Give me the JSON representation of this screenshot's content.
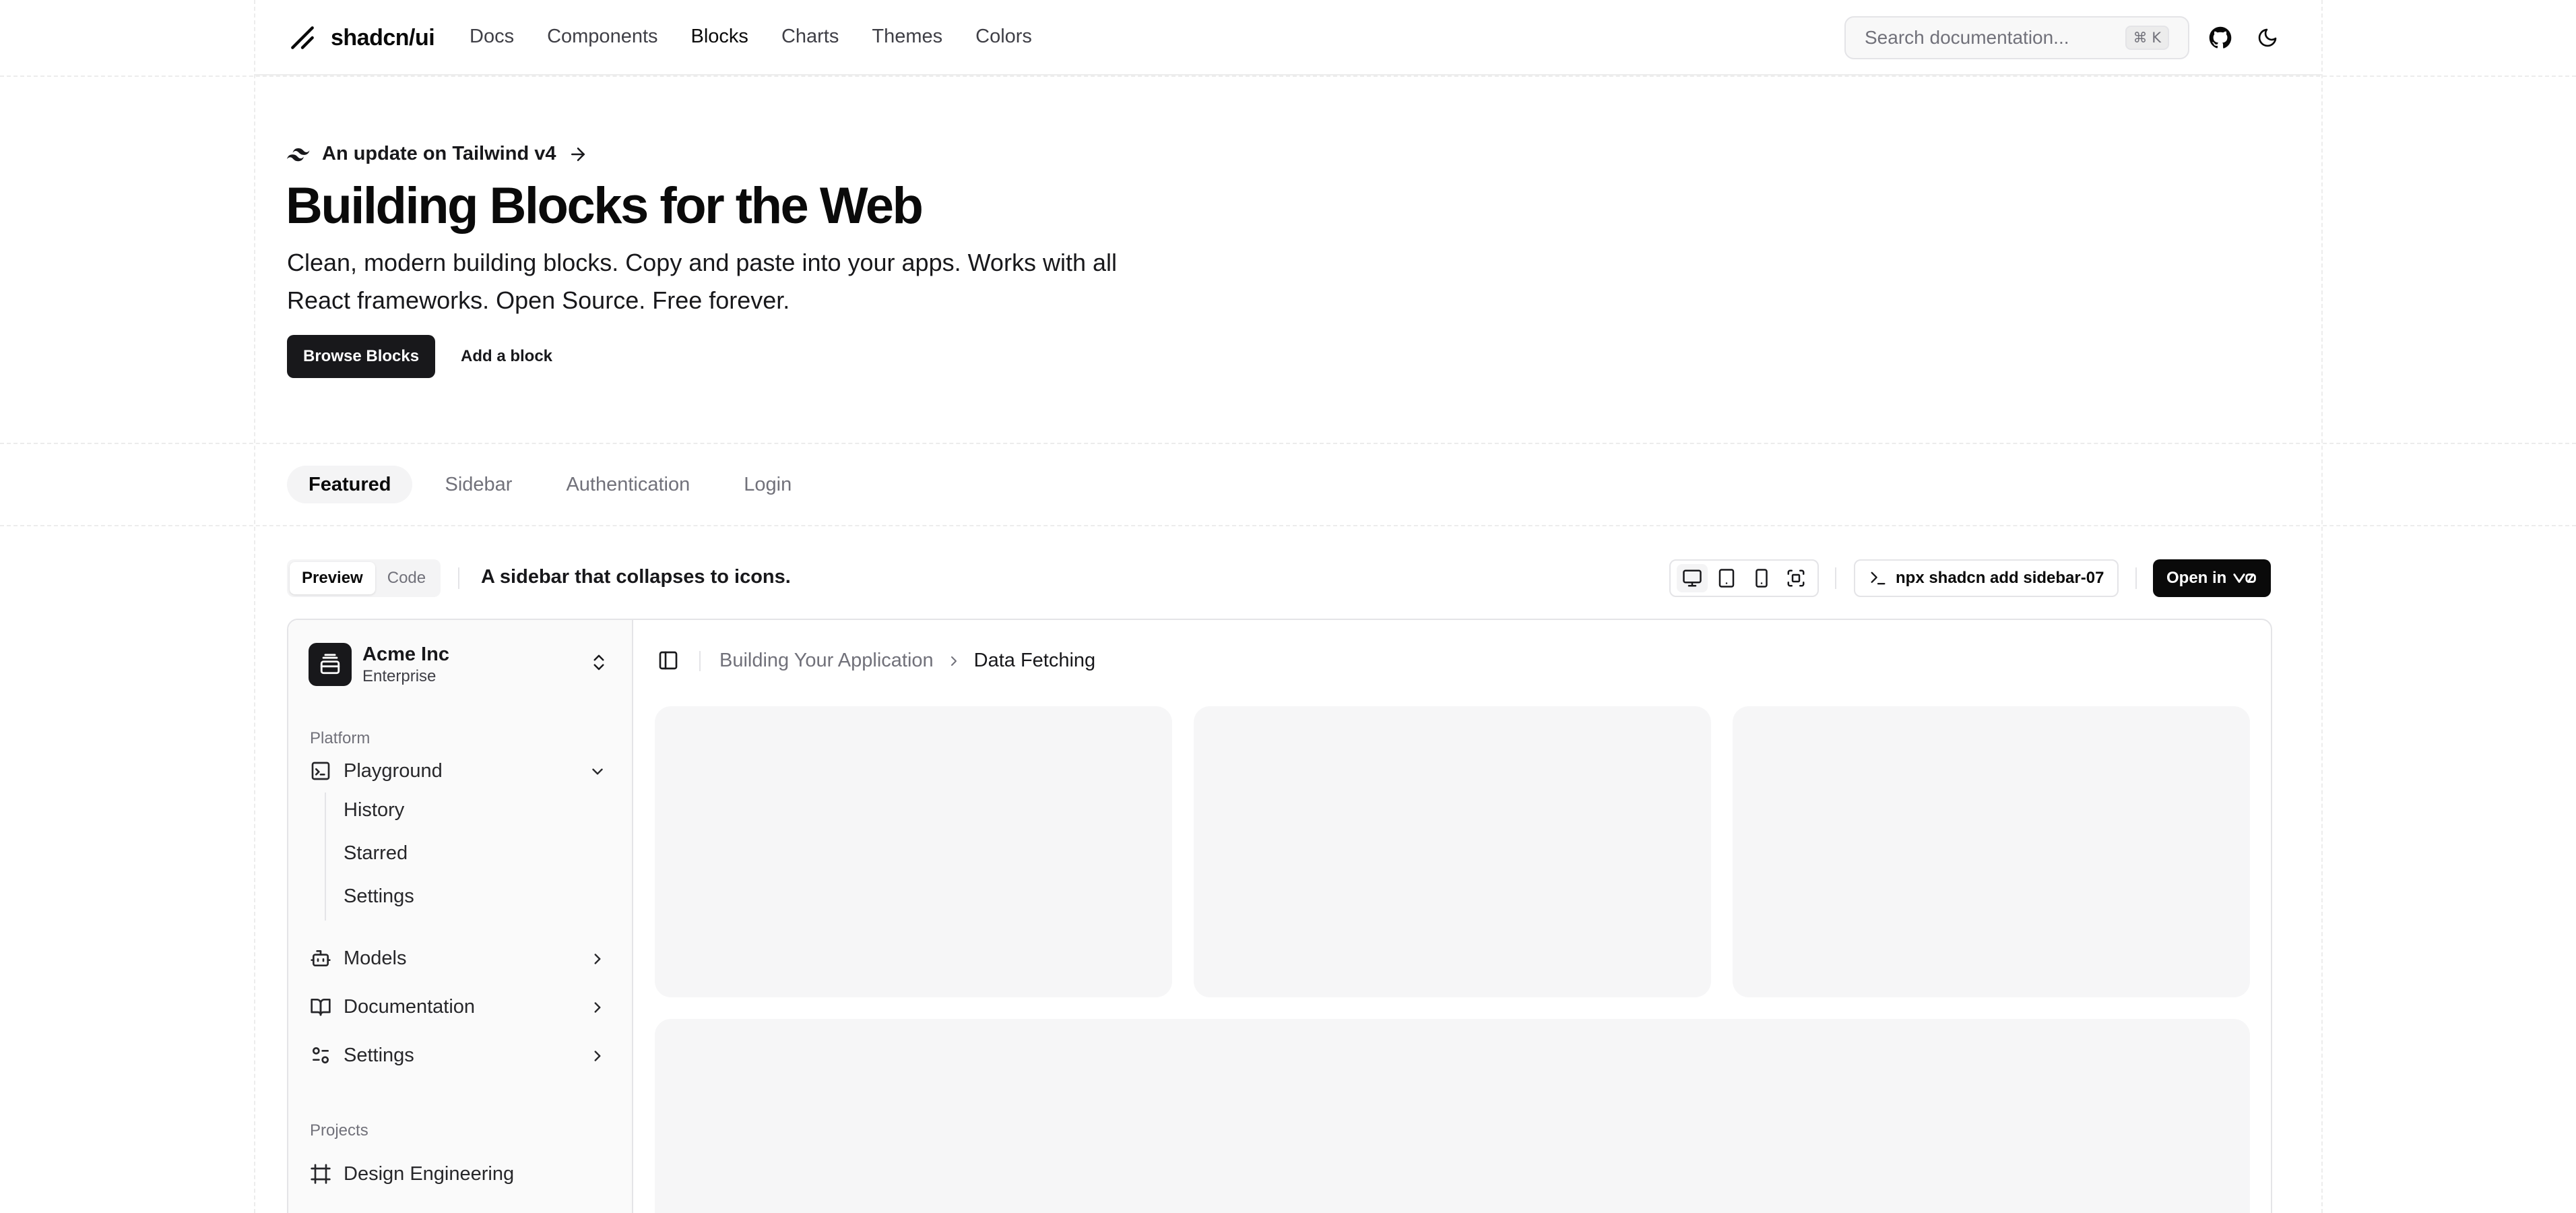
{
  "header": {
    "logo_text": "shadcn/ui",
    "nav": [
      "Docs",
      "Components",
      "Blocks",
      "Charts",
      "Themes",
      "Colors"
    ],
    "active_nav": "Blocks",
    "search_placeholder": "Search documentation...",
    "search_shortcut": "⌘ K",
    "icons": [
      "github-icon",
      "moon-icon"
    ]
  },
  "hero": {
    "announcement": "An update on Tailwind v4",
    "title": "Building Blocks for the Web",
    "description": "Clean, modern building blocks. Copy and paste into your apps. Works with all React frameworks. Open Source. Free forever.",
    "primary_button": "Browse Blocks",
    "secondary_button": "Add a block"
  },
  "tabs": {
    "items": [
      "Featured",
      "Sidebar",
      "Authentication",
      "Login"
    ],
    "active": "Featured"
  },
  "block_toolbar": {
    "view_modes": [
      "Preview",
      "Code"
    ],
    "active_view_mode": "Preview",
    "description": "A sidebar that collapses to icons.",
    "install_command": "npx shadcn add sidebar-07",
    "open_in_label": "Open in",
    "device_icons": [
      "desktop-icon",
      "tablet-icon",
      "phone-icon",
      "fullscreen-icon"
    ]
  },
  "preview": {
    "team": {
      "name": "Acme Inc",
      "plan": "Enterprise"
    },
    "platform_label": "Platform",
    "platform_items": [
      {
        "label": "Playground",
        "icon": "terminal-square-icon",
        "expanded": true,
        "subitems": [
          "History",
          "Starred",
          "Settings"
        ]
      },
      {
        "label": "Models",
        "icon": "bot-icon",
        "expanded": false
      },
      {
        "label": "Documentation",
        "icon": "book-open-icon",
        "expanded": false
      },
      {
        "label": "Settings",
        "icon": "settings-2-icon",
        "expanded": false
      }
    ],
    "projects_label": "Projects",
    "projects": [
      {
        "label": "Design Engineering",
        "icon": "frame-icon"
      }
    ],
    "breadcrumb": {
      "parent": "Building Your Application",
      "current": "Data Fetching"
    }
  },
  "colors": {
    "accent": "#18181b",
    "border": "#e4e4e7",
    "muted_text": "#71717a",
    "placeholder_card": "#f6f6f7"
  }
}
